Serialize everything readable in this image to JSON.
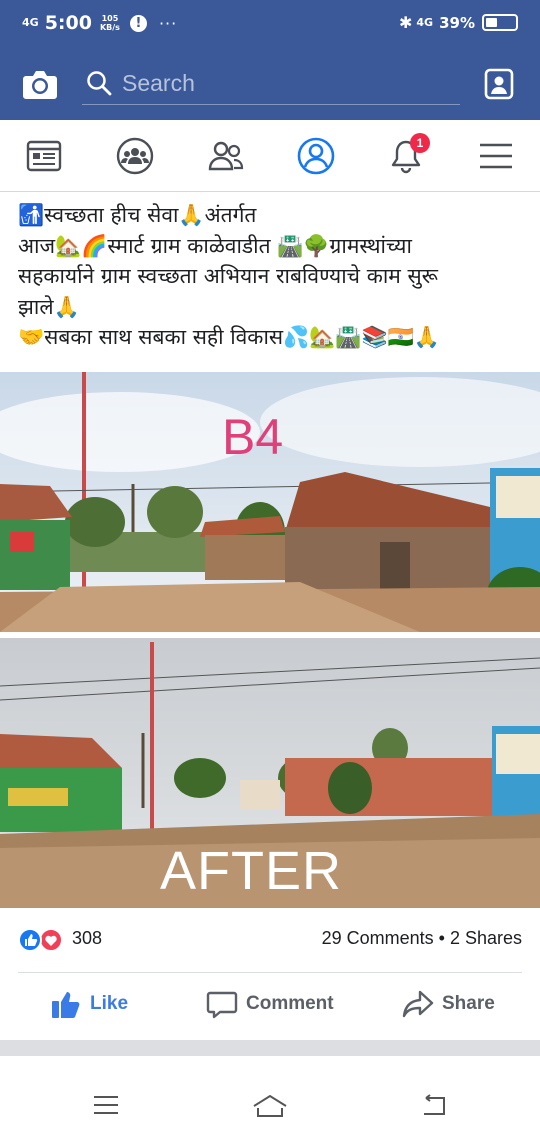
{
  "status_bar": {
    "signal": "4G",
    "time": "5:00",
    "speed_value": "105",
    "speed_unit": "KB/s",
    "alert": "!",
    "more": "···",
    "network": "4G",
    "battery": "39%",
    "battery_level": 0.39
  },
  "search": {
    "placeholder": "Search"
  },
  "nav": {
    "notification_badge": "1",
    "tabs": [
      "news-feed",
      "groups",
      "friends",
      "profile",
      "notifications",
      "menu"
    ]
  },
  "post": {
    "lines": [
      "🚮स्वच्छता हीच सेवा🙏अंतर्गत",
      "आज🏡🌈स्मार्ट ग्राम काळेवाडीत 🛣️🌳ग्रामस्थांच्या",
      "सहकार्याने ग्राम स्वच्छता अभियान राबविण्याचे काम सुरू",
      "झाले🙏",
      "🤝सबका साथ सबका सही विकास💦🏡🛣️📚🇮🇳🙏"
    ],
    "photo_before_label": "B4",
    "photo_after_label": "AFTER"
  },
  "reactions": {
    "count": "308",
    "comments": "29 Comments",
    "separator": "•",
    "shares": "2 Shares"
  },
  "actions": {
    "like": "Like",
    "comment": "Comment",
    "share": "Share"
  },
  "colors": {
    "brand": "#3b5998",
    "like_blue": "#3b7be8",
    "love_red": "#f33e58",
    "badge_red": "#f02849"
  }
}
